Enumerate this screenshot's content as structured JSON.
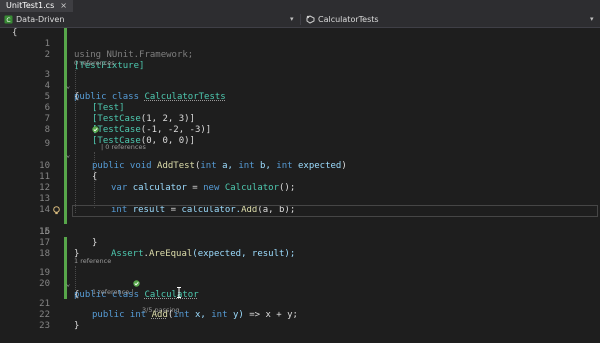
{
  "tab": {
    "title": "UnitTest1.cs",
    "close": "×"
  },
  "nav": {
    "project": "Data-Driven",
    "member": "CalculatorTests"
  },
  "colors": {
    "keyword": "#569cd6",
    "type": "#4ec9b0",
    "number": "#b5cea8",
    "method": "#dcdcaa",
    "param": "#9cdcfe",
    "change_bar": "#57a64a",
    "test_pass": "#57a64a"
  },
  "editor": {
    "cursor_glyph": "{",
    "line_numbers": [
      "1",
      "2",
      "3",
      "4",
      "5",
      "6",
      "7",
      "8",
      "9",
      "10",
      "11",
      "12",
      "13",
      "14",
      "15",
      "16",
      "17",
      "18",
      "19",
      "20",
      "21",
      "22"
    ],
    "lens": {
      "fixture": "0 references",
      "add_test": "| 0 references",
      "calculator": "1 reference",
      "add_method_refs": "1 reference |",
      "add_method_pass": "3/5 passing"
    },
    "lines": {
      "l1_using": "using",
      "l1_ns": "NUnit.Framework;",
      "l2": "[TestFixture]",
      "l3_kw": "public class",
      "l3_name": "CalculatorTests",
      "open_brace": "{",
      "close_brace": "}",
      "l5": "[Test]",
      "l6_attr": "[TestCase",
      "l6_args": "(1, 2, 3)]",
      "l7_attr": "[TestCase",
      "l7_args": "(-1, -2, -3)]",
      "l8_attr": "[TestCase",
      "l8_args": "(0, 0, 0)]",
      "l9_kw": "public void",
      "l9_name": "AddTest",
      "l9_open": "(",
      "l9_int1": "int",
      "l9_a": "a,",
      "l9_int2": "int",
      "l9_b": "b,",
      "l9_int3": "int",
      "l9_exp": "expected",
      "l9_close": ")",
      "l11_var": "var",
      "l11_calc": "calculator",
      "l11_eq": "=",
      "l11_new": "new",
      "l11_type": "Calculator",
      "l11_end": "();",
      "l13_int": "int",
      "l13_result": "result",
      "l13_eq": "=",
      "l13_calc": "calculator.",
      "l13_add": "Add",
      "l13_args": "(a, b);",
      "l15_assert": "Assert",
      "l15_dot": ".",
      "l15_method": "AreEqual",
      "l15_args": "(expected, result);",
      "l19_kw": "public class",
      "l19_name": "Calculator",
      "l21_kw": "public int",
      "l21_name": "Add",
      "l21_open": "(",
      "l21_int1": "int",
      "l21_x": "x,",
      "l21_int2": "int",
      "l21_y": "y)",
      "l21_body": "=> x + y;"
    }
  }
}
